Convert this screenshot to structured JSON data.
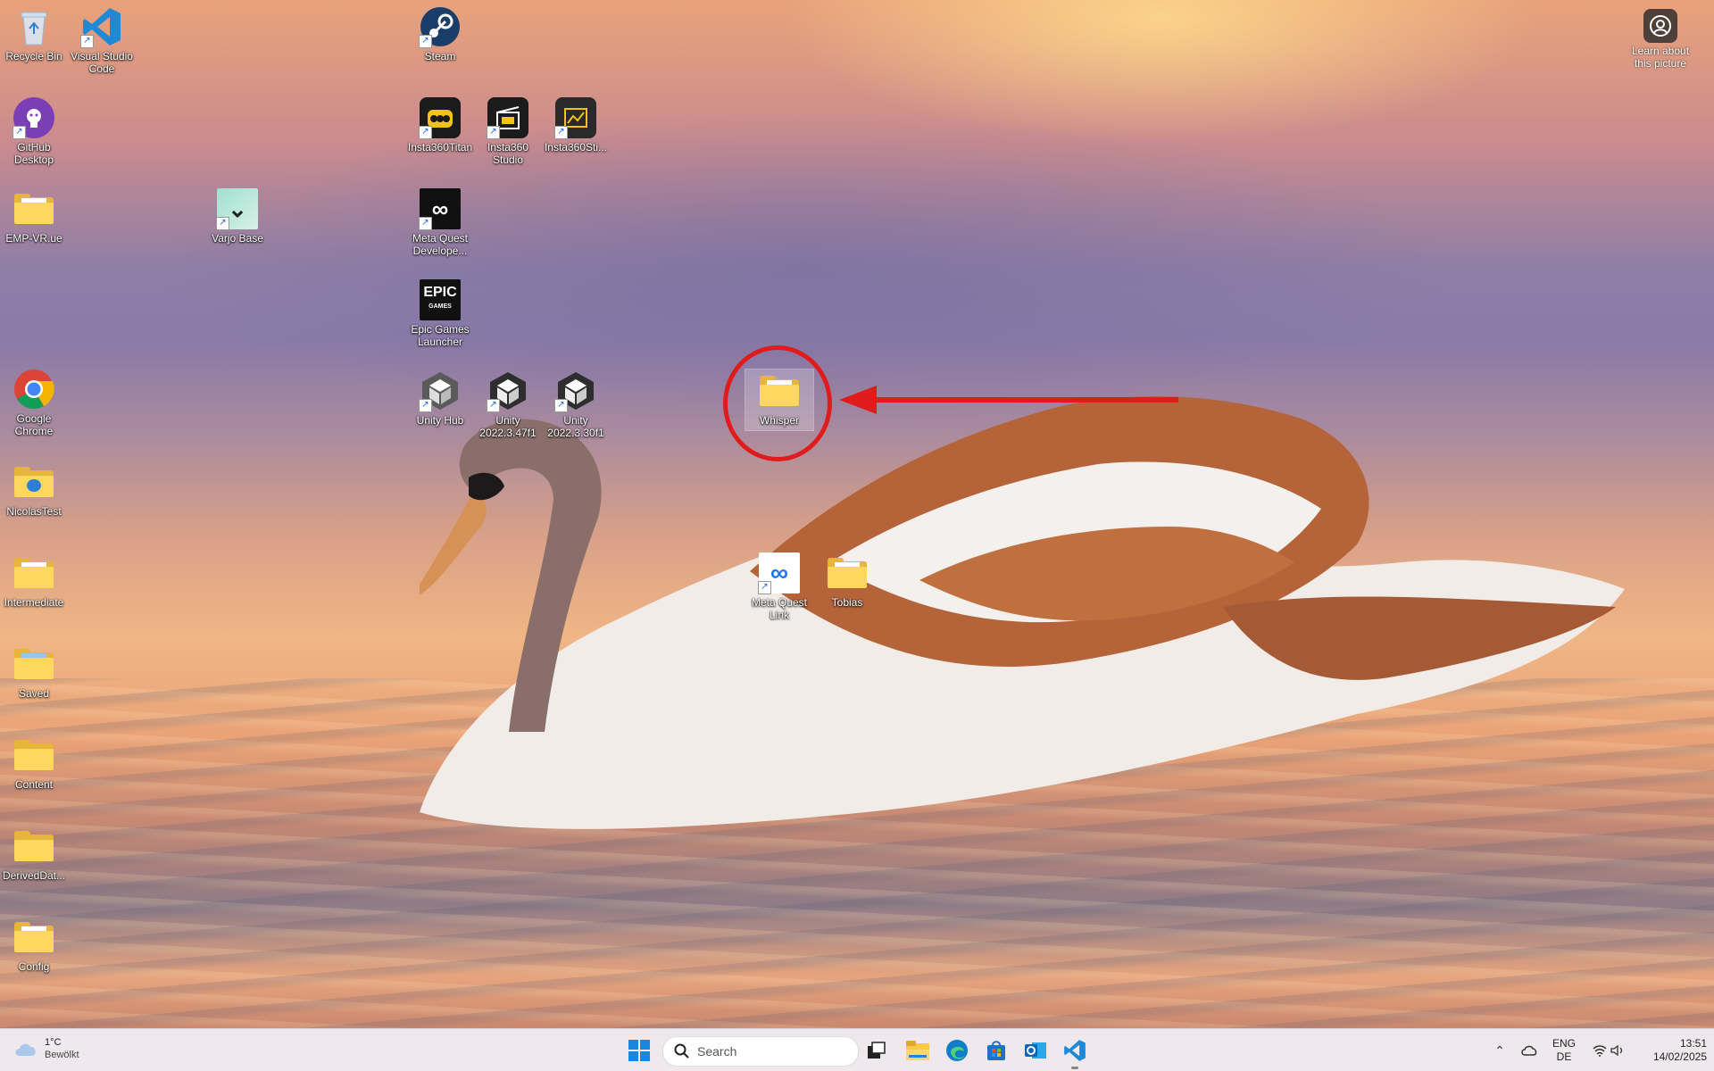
{
  "desktop": {
    "learn_about": "Learn about this picture",
    "icons": {
      "recycle_bin": "Recycle Bin",
      "vscode": "Visual Studio Code",
      "steam": "Steam",
      "github": "GitHub Desktop",
      "insta360titan": "Insta360Titan",
      "insta360studio": "Insta360 Studio",
      "insta360sti": "Insta360Sti...",
      "emp_vr": "EMP-VR.ue",
      "varjo": "Varjo Base",
      "meta_quest_dev": "Meta Quest Develope...",
      "epic": "Epic Games Launcher",
      "chrome": "Google Chrome",
      "unity_hub": "Unity Hub",
      "unity_2022_3_47": "Unity 2022.3.47f1",
      "unity_2022_3_30": "Unity 2022.3.30f1",
      "whisper": "Whisper",
      "nicolas": "NicolasTest",
      "intermediate": "Intermediate",
      "meta_quest_link": "Meta Quest Link",
      "tobias": "Tobias",
      "saved": "Saved",
      "content": "Content",
      "derived": "DerivedDat...",
      "config": "Config"
    },
    "epic_logo_text": "EPIC",
    "epic_logo_sub": "GAMES"
  },
  "taskbar": {
    "weather_temp": "1°C",
    "weather_desc": "Bewölkt",
    "search_placeholder": "Search",
    "lang_top": "ENG",
    "lang_bottom": "DE",
    "time": "13:51",
    "date": "14/02/2025"
  },
  "colors": {
    "annotation": "#e01b1b",
    "taskbar_bg": "#eee8ec"
  }
}
